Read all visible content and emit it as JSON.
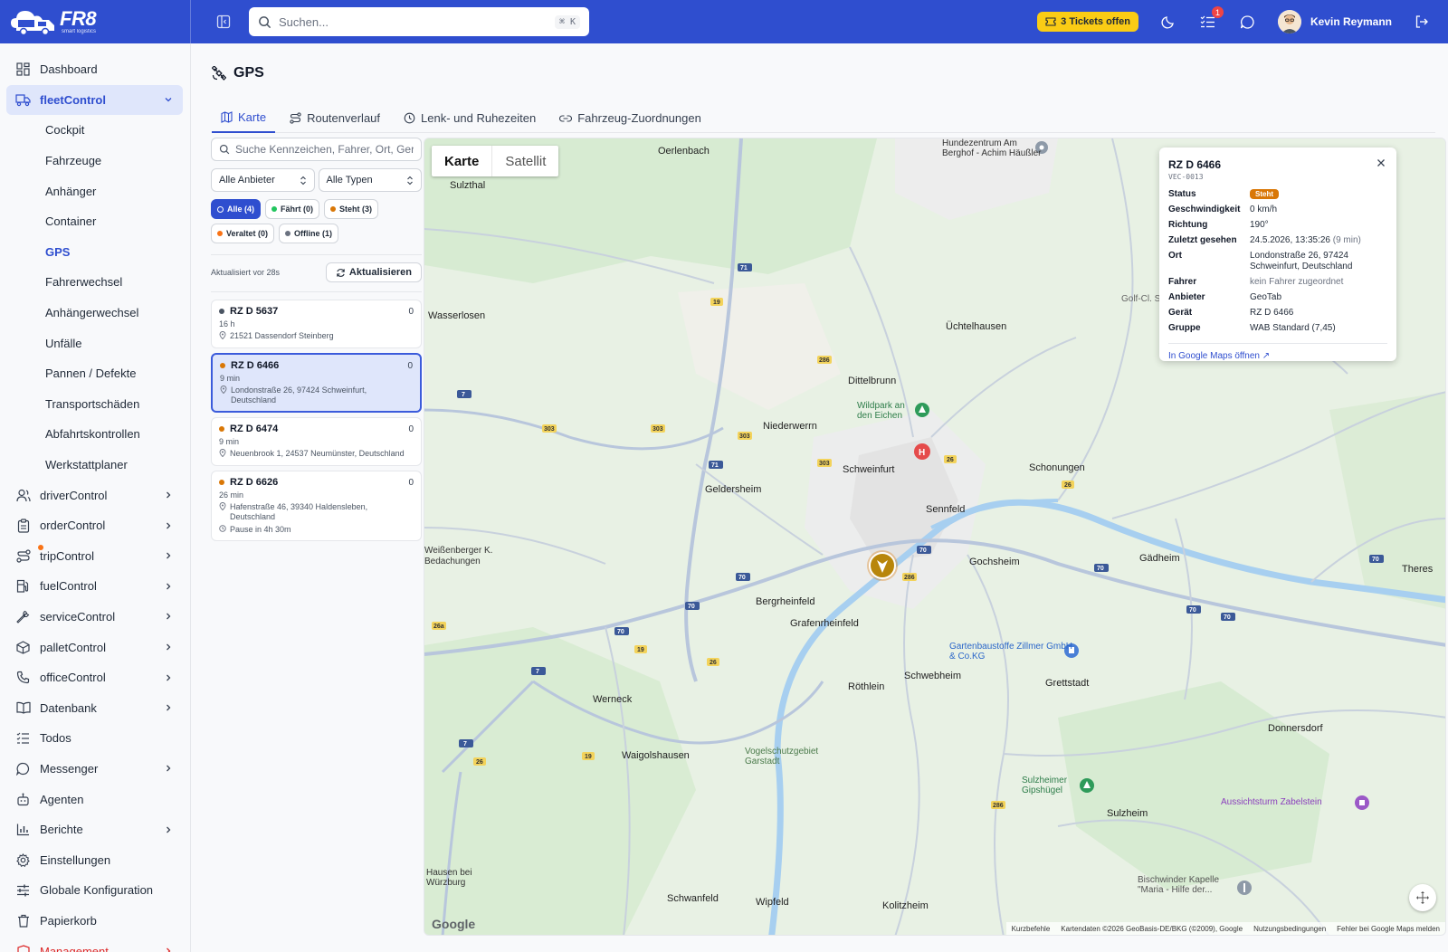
{
  "brand": {
    "name": "FR8",
    "tagline": "smart logistics"
  },
  "search": {
    "placeholder": "Suchen...",
    "shortcut": "⌘ K"
  },
  "header": {
    "tickets_label": "3 Tickets offen",
    "notification_count": "1",
    "user_name": "Kevin Reymann"
  },
  "sidebar": {
    "items_top": [
      {
        "label": "Dashboard",
        "icon": "dashboard-icon"
      }
    ],
    "fleet": {
      "label": "fleetControl",
      "icon": "truck-icon"
    },
    "fleet_sub": [
      "Cockpit",
      "Fahrzeuge",
      "Anhänger",
      "Container",
      "GPS",
      "Fahrerwechsel",
      "Anhängerwechsel",
      "Unfälle",
      "Pannen / Defekte",
      "Transportschäden",
      "Abfahrtskontrollen",
      "Werkstattplaner"
    ],
    "items": [
      {
        "label": "driverControl",
        "icon": "users-icon",
        "chevron": true
      },
      {
        "label": "orderControl",
        "icon": "clipboard-icon",
        "chevron": true
      },
      {
        "label": "tripControl",
        "icon": "route-icon",
        "chevron": true
      },
      {
        "label": "fuelControl",
        "icon": "fuel-icon",
        "chevron": true
      },
      {
        "label": "serviceControl",
        "icon": "wrench-icon",
        "chevron": true
      },
      {
        "label": "palletControl",
        "icon": "box-icon",
        "chevron": true
      },
      {
        "label": "officeControl",
        "icon": "phone-icon",
        "chevron": true
      },
      {
        "label": "Datenbank",
        "icon": "book-icon",
        "chevron": true
      },
      {
        "label": "Todos",
        "icon": "list-icon",
        "chevron": false
      },
      {
        "label": "Messenger",
        "icon": "message-icon",
        "chevron": true
      },
      {
        "label": "Agenten",
        "icon": "bot-icon",
        "chevron": false
      },
      {
        "label": "Berichte",
        "icon": "chart-icon",
        "chevron": true
      },
      {
        "label": "Einstellungen",
        "icon": "gear-icon",
        "chevron": false
      },
      {
        "label": "Globale Konfiguration",
        "icon": "sliders-icon",
        "chevron": false
      },
      {
        "label": "Papierkorb",
        "icon": "trash-icon",
        "chevron": false
      },
      {
        "label": "Management",
        "icon": "shield-icon",
        "chevron": true
      }
    ]
  },
  "page": {
    "title": "GPS"
  },
  "tabs": [
    "Karte",
    "Routenverlauf",
    "Lenk- und Ruhezeiten",
    "Fahrzeug-Zuordnungen"
  ],
  "filters": {
    "search_placeholder": "Suche Kennzeichen, Fahrer, Ort, Gerät...",
    "provider": "Alle Anbieter",
    "type": "Alle Typen",
    "chips": [
      {
        "label": "Alle (4)",
        "color": "#ffffff"
      },
      {
        "label": "Fährt (0)",
        "color": "#22c55e"
      },
      {
        "label": "Steht (3)",
        "color": "#d97706"
      },
      {
        "label": "Veraltet (0)",
        "color": "#f97316"
      },
      {
        "label": "Offline (1)",
        "color": "#6b7280"
      }
    ],
    "updated": "Aktualisiert vor 28s",
    "refresh_label": "Aktualisieren"
  },
  "vehicles": [
    {
      "plate": "RZ D 5637",
      "count": "0",
      "age": "16 h",
      "address": "21521 Dassendorf Steinberg",
      "color": "#4b5563"
    },
    {
      "plate": "RZ D 6466",
      "count": "0",
      "age": "9 min",
      "address": "Londonstraße 26, 97424 Schweinfurt, Deutschland",
      "color": "#d97706"
    },
    {
      "plate": "RZ D 6474",
      "count": "0",
      "age": "9 min",
      "address": "Neuenbrook 1, 24537 Neumünster, Deutschland",
      "color": "#d97706"
    },
    {
      "plate": "RZ D 6626",
      "count": "0",
      "age": "26 min",
      "address": "Hafenstraße 46, 39340 Haldensleben, Deutschland",
      "extra": "Pause in 4h 30m",
      "color": "#d97706"
    }
  ],
  "map": {
    "toggle": [
      "Karte",
      "Satellit"
    ],
    "google": "Google",
    "attribution": [
      "Kurzbefehle",
      "Kartendaten ©2026 GeoBasis-DE/BKG (©2009), Google",
      "Nutzungsbedingungen",
      "Fehler bei Google Maps melden"
    ],
    "towns": [
      "Oerlenbach",
      "Sulzthal",
      "Wasserlosen",
      "Üchtelhausen",
      "Dittelbrunn",
      "Niederwerrn",
      "Schweinfurt",
      "Schonungen",
      "Geldersheim",
      "Sennfeld",
      "Gochsheim",
      "Gädheim",
      "Theres",
      "Bergrheinfeld",
      "Grafenrheinfeld",
      "Röthlein",
      "Schwebheim",
      "Grettstadt",
      "Werneck",
      "Waigolshausen",
      "Donnersdorf",
      "Sulzheim",
      "Schwanfeld",
      "Wipfeld",
      "Kolitzheim",
      "Weißenberger K. Bedachungen"
    ],
    "places": [
      "Hundezentrum Am Berghof - Achim Häußler",
      "Wildpark an den Eichen",
      "Gartenbaustoffe Zillmer GmbH & Co.KG",
      "Vogelschutzgebiet Garstadt",
      "Sulzheimer Gipshügel",
      "Aussichtsturm Zabelstein",
      "Bischwinder Kapelle \"Maria - Hilfe der...",
      "Hausen bei Würzburg",
      "Golf-Cl. Schweinfurt"
    ]
  },
  "popup": {
    "title": "RZ D 6466",
    "subtitle": "VEC-0013",
    "status_label": "Status",
    "status_value": "Steht",
    "speed_label": "Geschwindigkeit",
    "speed_value": "0 km/h",
    "direction_label": "Richtung",
    "direction_value": "190°",
    "last_seen_label": "Zuletzt gesehen",
    "last_seen_value": "24.5.2026, 13:35:26",
    "last_seen_ago": "(9 min)",
    "place_label": "Ort",
    "place_value": "Londonstraße 26, 97424 Schweinfurt, Deutschland",
    "driver_label": "Fahrer",
    "driver_value": "kein Fahrer zugeordnet",
    "provider_label": "Anbieter",
    "provider_value": "GeoTab",
    "device_label": "Gerät",
    "device_value": "RZ D 6466",
    "group_label": "Gruppe",
    "group_value": "WAB Standard (7,45)",
    "link": "In Google Maps öffnen ↗"
  }
}
